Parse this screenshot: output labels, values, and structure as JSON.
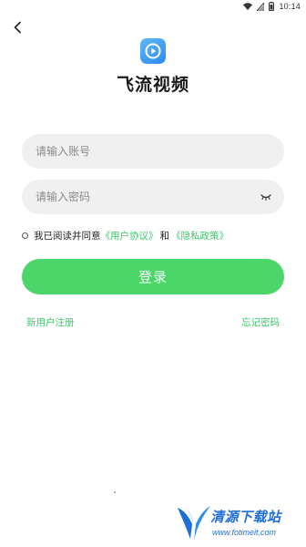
{
  "status_bar": {
    "time": "10:14",
    "icons": [
      "wifi-icon",
      "signal-icon",
      "battery-icon"
    ]
  },
  "header": {
    "back_icon": "back-arrow-icon"
  },
  "app": {
    "logo_icon": "play-icon",
    "name": "飞流视频"
  },
  "form": {
    "account_placeholder": "请输入账号",
    "account_value": "",
    "password_placeholder": "请输入密码",
    "password_value": "",
    "password_toggle_icon": "eye-closed-icon"
  },
  "agreement": {
    "checked": false,
    "prefix": "我已阅读并同意",
    "user_agreement": "《用户协议》",
    "and": "和",
    "privacy_policy": "《隐私政策》"
  },
  "login_button": "登录",
  "links": {
    "register": "新用户注册",
    "forgot_password": "忘记密码"
  },
  "watermark": {
    "title": "清源下载站",
    "url": "www.fotimeit.com"
  },
  "colors": {
    "accent_green": "#4cd669",
    "link_green": "#3cc76a",
    "input_bg": "#f0f0f0",
    "logo_blue": "#2b8bef",
    "watermark_blue": "#1d6fd6"
  }
}
